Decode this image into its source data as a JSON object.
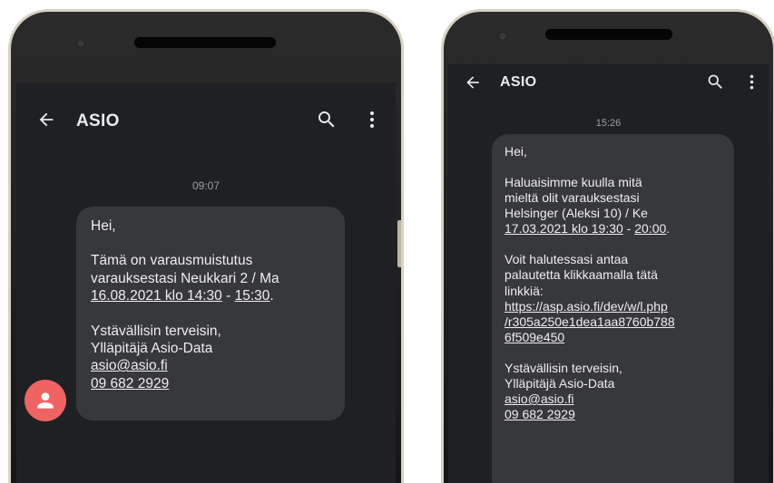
{
  "phone1": {
    "app_title": "ASIO",
    "icons": {
      "back": "arrow-left-icon",
      "search": "search-icon",
      "more": "more-vert-icon",
      "avatar": "person-icon"
    },
    "time": "09:07",
    "message": {
      "greeting": "Hei,",
      "reminder_line1": "Tämä on varausmuistutus",
      "reminder_line2": "varauksestasi Neukkari 2 / Ma",
      "date_link": "16.08.2021 klo 14:30",
      "dash": " - ",
      "end_link": "15:30",
      "period": ".",
      "regards": "Ystävällisin terveisin,",
      "sender": "Ylläpitäjä Asio-Data",
      "email": "asio@asio.fi",
      "phone": "09 682 2929"
    }
  },
  "phone2": {
    "app_title": "ASIO",
    "icons": {
      "back": "arrow-left-icon",
      "search": "search-icon",
      "more": "more-vert-icon"
    },
    "time": "15:26",
    "message": {
      "greeting": "Hei,",
      "feedback_line1": "Haluaisimme kuulla mitä",
      "feedback_line2": "mieltä olit varauksestasi",
      "feedback_line3": "Helsinger (Aleksi 10) / Ke",
      "date_link": "17.03.2021 klo 19:30",
      "dash": " - ",
      "end_link": "20:00",
      "period": ".",
      "voit_line1": "Voit halutessasi antaa",
      "voit_line2": "palautetta klikkaamalla tätä",
      "voit_line3": "linkkiä:",
      "url_line1": "https://asp.asio.fi/dev/w/l.php",
      "url_line2": "/r305a250e1dea1aa8760b788",
      "url_line3": "6f509e450",
      "regards": "Ystävällisin terveisin,",
      "sender": "Ylläpitäjä Asio-Data",
      "email": "asio@asio.fi",
      "phone": "09 682 2929"
    }
  }
}
